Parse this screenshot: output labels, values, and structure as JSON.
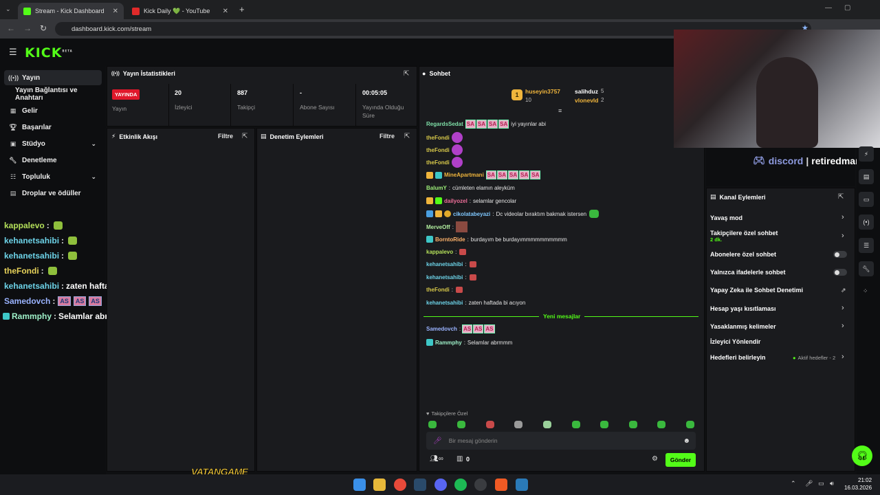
{
  "browser": {
    "tabs": [
      {
        "label": "Stream - Kick Dashboard",
        "active": true
      },
      {
        "label": "Kick Daily 💚 - YouTube",
        "active": false
      }
    ],
    "url": "dashboard.kick.com/stream"
  },
  "app": {
    "logo": "KICK",
    "logo_sup": "BETA"
  },
  "sidebar": {
    "items": [
      {
        "label": "Yayın",
        "icon": "broadcast-icon",
        "active": true
      },
      {
        "label": "Yayın Bağlantısı ve Anahtarı",
        "icon": "",
        "active": false
      },
      {
        "label": "Gelir",
        "icon": "grid-icon",
        "active": false
      },
      {
        "label": "Başarılar",
        "icon": "trophy-icon",
        "active": false
      },
      {
        "label": "Stüdyo",
        "icon": "video-icon",
        "active": false,
        "expand": true
      },
      {
        "label": "Denetleme",
        "icon": "wrench-icon",
        "active": false
      },
      {
        "label": "Topluluk",
        "icon": "people-icon",
        "active": false,
        "expand": true
      },
      {
        "label": "Droplar ve ödüller",
        "icon": "gift-icon",
        "active": false
      }
    ]
  },
  "overlay_chat": [
    {
      "user": "kappalevo",
      "color": "#b4e05a",
      "text": ""
    },
    {
      "user": "kehanetsahibi",
      "color": "#6dd3e8",
      "text": ""
    },
    {
      "user": "kehanetsahibi",
      "color": "#6dd3e8",
      "text": ""
    },
    {
      "user": "theFondi",
      "color": "#e8d35a",
      "text": ""
    },
    {
      "user": "kehanetsahibi",
      "color": "#6dd3e8",
      "text": "zaten haftada bi acıyon"
    },
    {
      "user": "Samedovch",
      "color": "#9ab3ff",
      "text": ""
    },
    {
      "user": "Rammphy",
      "color": "#9ef0c8",
      "text": "Selamlar abrmmm"
    }
  ],
  "stats": {
    "title": "Yayın İstatistikleri",
    "status_badge": "YAYINDA",
    "status_label": "Yayın",
    "viewers": "20",
    "viewers_label": "İzleyici",
    "followers": "887",
    "followers_label": "Takipçi",
    "subs": "-",
    "subs_label": "Abone Sayısı",
    "uptime": "00:05:05",
    "uptime_label": "Yayında Olduğu Süre"
  },
  "activity": {
    "title": "Etkinlik Akışı",
    "filter": "Filtre"
  },
  "moderation": {
    "title": "Denetim Eylemleri",
    "filter": "Filtre"
  },
  "chat": {
    "title": "Sohbet",
    "leaders": [
      {
        "name": "huseyin3757",
        "count": "10",
        "rank": "1"
      },
      {
        "name": "salihduz",
        "count": "5"
      },
      {
        "name": "vlonevld",
        "count": "2"
      }
    ],
    "messages": [
      {
        "user": "RegardsSedat",
        "color": "#7fe0a8",
        "text": "iyi yayınlar abi",
        "sa": 4
      },
      {
        "user": "theFondi",
        "color": "#d8c94a",
        "text": "",
        "emote": "purple"
      },
      {
        "user": "theFondi",
        "color": "#d8c94a",
        "text": "",
        "emote": "purple"
      },
      {
        "user": "theFondi",
        "color": "#d8c94a",
        "text": "",
        "emote": "purple"
      },
      {
        "user": "MineApartmani",
        "color": "#f0b53c",
        "text": "",
        "sa": 5
      },
      {
        "user": "BalumY",
        "color": "#9ef07a",
        "text": "cümleten elamın aleyküm"
      },
      {
        "user": "dailyozel",
        "color": "#f06f9a",
        "text": "selamlar gencolar"
      },
      {
        "user": "cikolatabeyazi",
        "color": "#7fc8ff",
        "text": "Dc videolar bıraktım bakmak istersen"
      },
      {
        "user": "MerveOff",
        "color": "#b3f0a0",
        "text": ""
      },
      {
        "user": "BorntoRide",
        "color": "#ffb36b",
        "text": "burdayım be burdayımmmmmmmmmm"
      },
      {
        "user": "kappalevo",
        "color": "#b4e05a",
        "text": ""
      },
      {
        "user": "kehanetsahibi",
        "color": "#6dd3e8",
        "text": ""
      },
      {
        "user": "kehanetsahibi",
        "color": "#6dd3e8",
        "text": ""
      },
      {
        "user": "theFondi",
        "color": "#d8c94a",
        "text": ""
      },
      {
        "user": "kehanetsahibi",
        "color": "#6dd3e8",
        "text": "zaten haftada bi acıyon"
      }
    ],
    "new_messages": "Yeni mesajlar",
    "after": [
      {
        "user": "Samedovch",
        "color": "#9ab3ff",
        "text": "",
        "as": 3
      },
      {
        "user": "Rammphy",
        "color": "#9ef0c8",
        "text": "Selamlar abrmmm"
      }
    ],
    "followers_only": "Takipçilere Özel",
    "input_placeholder": "Bir mesaj gönderin",
    "count": "0",
    "send": "Gönder"
  },
  "channel_actions": {
    "title": "Kanal Eylemleri",
    "items": [
      {
        "label": "Yavaş mod",
        "type": "chevron"
      },
      {
        "label": "Takipçilere özel sohbet",
        "sub": "2 dk.",
        "type": "chevron"
      },
      {
        "label": "Abonelere özel sohbet",
        "type": "toggle"
      },
      {
        "label": "Yalnızca ifadelerle sohbet",
        "type": "toggle"
      },
      {
        "label": "Yapay Zeka ile Sohbet Denetimi",
        "type": "external"
      },
      {
        "label": "Hesap yaşı kısıtlaması",
        "type": "chevron"
      },
      {
        "label": "Yasaklanmış kelimeler",
        "type": "chevron"
      },
      {
        "label": "İzleyici Yönlendir",
        "type": "none"
      },
      {
        "label": "Hedefleri belirleyin",
        "type": "chevron",
        "extra": "Aktif hedefler - 2"
      }
    ]
  },
  "overlay": {
    "discord": "discord",
    "handle": "retiredman",
    "watermark": "VATANGAME"
  },
  "system": {
    "time": "21:02",
    "date": "16.03.2026"
  }
}
